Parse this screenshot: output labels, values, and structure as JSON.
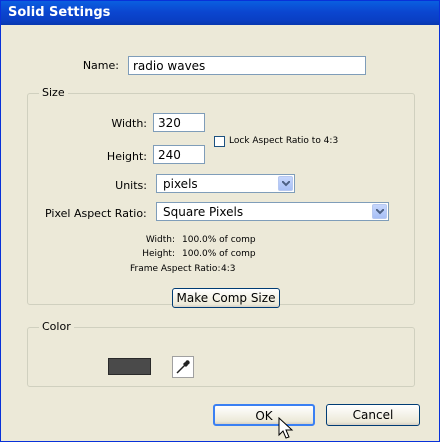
{
  "dialog": {
    "title": "Solid Settings"
  },
  "name": {
    "label": "Name:",
    "value": "radio waves"
  },
  "size": {
    "group_label": "Size",
    "width_label": "Width:",
    "width_value": "320",
    "height_label": "Height:",
    "height_value": "240",
    "lock_label": "Lock Aspect Ratio to 4:3",
    "lock_checked": false,
    "units_label": "Units:",
    "units_value": "pixels",
    "par_label": "Pixel Aspect Ratio:",
    "par_value": "Square Pixels",
    "info": {
      "width_label": "Width:",
      "width_value": "100.0% of comp",
      "height_label": "Height:",
      "height_value": "100.0% of comp",
      "frame_label": "Frame Aspect Ratio:",
      "frame_value": "4:3"
    },
    "make_comp_size_label": "Make Comp Size"
  },
  "color": {
    "group_label": "Color",
    "swatch_color": "#4a4a4a"
  },
  "buttons": {
    "ok_label": "OK",
    "cancel_label": "Cancel"
  },
  "colors": {
    "titlebar": "#0a46d0",
    "dialog_bg": "#ece9d8"
  }
}
